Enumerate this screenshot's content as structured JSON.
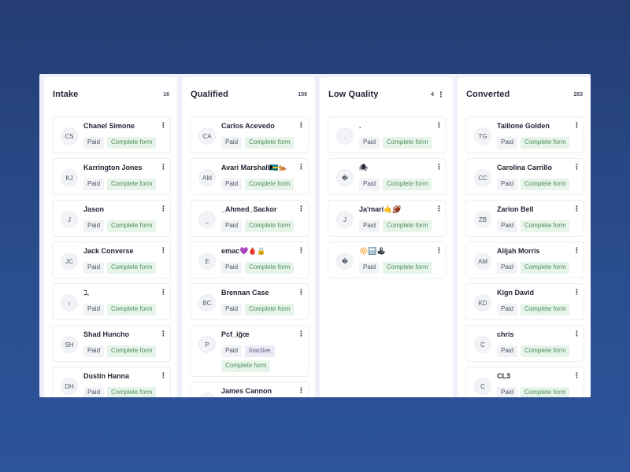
{
  "columns": [
    {
      "id": "intake",
      "title": "Intake",
      "count": "16",
      "has_menu": false,
      "cards": [
        {
          "initials": "CS",
          "name": "Chanel Simone",
          "tags": [
            {
              "label": "Paid",
              "style": "gray"
            },
            {
              "label": "Complete form",
              "style": "green"
            }
          ]
        },
        {
          "initials": "KJ",
          "name": "Karrington Jones",
          "tags": [
            {
              "label": "Paid",
              "style": "gray"
            },
            {
              "label": "Complete form",
              "style": "green"
            }
          ]
        },
        {
          "initials": "J",
          "name": "Jason",
          "tags": [
            {
              "label": "Paid",
              "style": "gray"
            },
            {
              "label": "Complete form",
              "style": "green"
            }
          ]
        },
        {
          "initials": "JC",
          "name": "Jack Converse",
          "tags": [
            {
              "label": "Paid",
              "style": "gray"
            },
            {
              "label": "Complete form",
              "style": "green"
            }
          ]
        },
        {
          "initials": "ı",
          "name": "ℷ,",
          "tags": [
            {
              "label": "Paid",
              "style": "gray"
            },
            {
              "label": "Complete form",
              "style": "green"
            }
          ]
        },
        {
          "initials": "SH",
          "name": "Shad Huncho",
          "tags": [
            {
              "label": "Paid",
              "style": "gray"
            },
            {
              "label": "Complete form",
              "style": "green"
            }
          ]
        },
        {
          "initials": "DH",
          "name": "Dustin Hanna",
          "tags": [
            {
              "label": "Paid",
              "style": "gray"
            },
            {
              "label": "Complete form",
              "style": "green"
            }
          ]
        }
      ]
    },
    {
      "id": "qualified",
      "title": "Qualified",
      "count": "159",
      "has_menu": false,
      "cards": [
        {
          "initials": "CA",
          "name": "Carlos Acevedo",
          "tags": [
            {
              "label": "Paid",
              "style": "gray"
            },
            {
              "label": "Complete form",
              "style": "green"
            }
          ]
        },
        {
          "initials": "AM",
          "name": "Avari Marshall🇧🇸🐅",
          "tags": [
            {
              "label": "Paid",
              "style": "gray"
            },
            {
              "label": "Complete form",
              "style": "green"
            }
          ]
        },
        {
          "initials": "_",
          "name": "_Ahmed_Sackor",
          "tags": [
            {
              "label": "Paid",
              "style": "gray"
            },
            {
              "label": "Complete form",
              "style": "green"
            }
          ]
        },
        {
          "initials": "E",
          "name": "emac💜🩸🔒",
          "tags": [
            {
              "label": "Paid",
              "style": "gray"
            },
            {
              "label": "Complete form",
              "style": "green"
            }
          ]
        },
        {
          "initials": "BC",
          "name": "Brennan Case",
          "tags": [
            {
              "label": "Paid",
              "style": "gray"
            },
            {
              "label": "Complete form",
              "style": "green"
            }
          ]
        },
        {
          "initials": "P",
          "name": "Pcf_iğœ",
          "tags": [
            {
              "label": "Paid",
              "style": "gray"
            },
            {
              "label": "Inactive",
              "style": "purple"
            },
            {
              "label": "Complete form",
              "style": "green"
            }
          ]
        },
        {
          "initials": "JC",
          "name": "James Cannon",
          "tags": []
        }
      ]
    },
    {
      "id": "low-quality",
      "title": "Low Quality",
      "count": "4",
      "has_menu": true,
      "cards": [
        {
          "initials": ".",
          "name": ".",
          "tags": [
            {
              "label": "Paid",
              "style": "gray"
            },
            {
              "label": "Complete form",
              "style": "green"
            }
          ]
        },
        {
          "initials": "�",
          "name": "🕷",
          "tags": [
            {
              "label": "Paid",
              "style": "gray"
            },
            {
              "label": "Complete form",
              "style": "green"
            }
          ]
        },
        {
          "initials": "J",
          "name": "Ja'mari🤙🏈",
          "tags": [
            {
              "label": "Paid",
              "style": "gray"
            },
            {
              "label": "Complete form",
              "style": "green"
            }
          ]
        },
        {
          "initials": "�",
          "name": "🔆🔛🕹",
          "tags": [
            {
              "label": "Paid",
              "style": "gray"
            },
            {
              "label": "Complete form",
              "style": "green"
            }
          ]
        }
      ]
    },
    {
      "id": "converted",
      "title": "Converted",
      "count": "283",
      "has_menu": false,
      "cards": [
        {
          "initials": "TG",
          "name": "Taillone Golden",
          "tags": [
            {
              "label": "Paid",
              "style": "gray"
            },
            {
              "label": "Complete form",
              "style": "green"
            }
          ]
        },
        {
          "initials": "CC",
          "name": "Carolina Carrillo",
          "tags": [
            {
              "label": "Paid",
              "style": "gray"
            },
            {
              "label": "Complete form",
              "style": "green"
            }
          ]
        },
        {
          "initials": "ZB",
          "name": "Zarion Bell",
          "tags": [
            {
              "label": "Paid",
              "style": "gray"
            },
            {
              "label": "Complete form",
              "style": "green"
            }
          ]
        },
        {
          "initials": "AM",
          "name": "Alijah Morris",
          "tags": [
            {
              "label": "Paid",
              "style": "gray"
            },
            {
              "label": "Complete form",
              "style": "green"
            }
          ]
        },
        {
          "initials": "KD",
          "name": "Kign David",
          "tags": [
            {
              "label": "Paid",
              "style": "gray"
            },
            {
              "label": "Complete form",
              "style": "green"
            }
          ]
        },
        {
          "initials": "C",
          "name": "chris",
          "tags": [
            {
              "label": "Paid",
              "style": "gray"
            },
            {
              "label": "Complete form",
              "style": "green"
            }
          ]
        },
        {
          "initials": "C",
          "name": "CL3",
          "tags": [
            {
              "label": "Paid",
              "style": "gray"
            },
            {
              "label": "Complete form",
              "style": "green"
            }
          ]
        }
      ]
    }
  ],
  "icons": {
    "kebab": "vertical-ellipsis-icon"
  },
  "colors": {
    "background": "#2a4d8e",
    "tag_green_bg": "#e7f4ea",
    "tag_green_text": "#4d8d5e",
    "tag_purple_bg": "#eceaf6"
  }
}
